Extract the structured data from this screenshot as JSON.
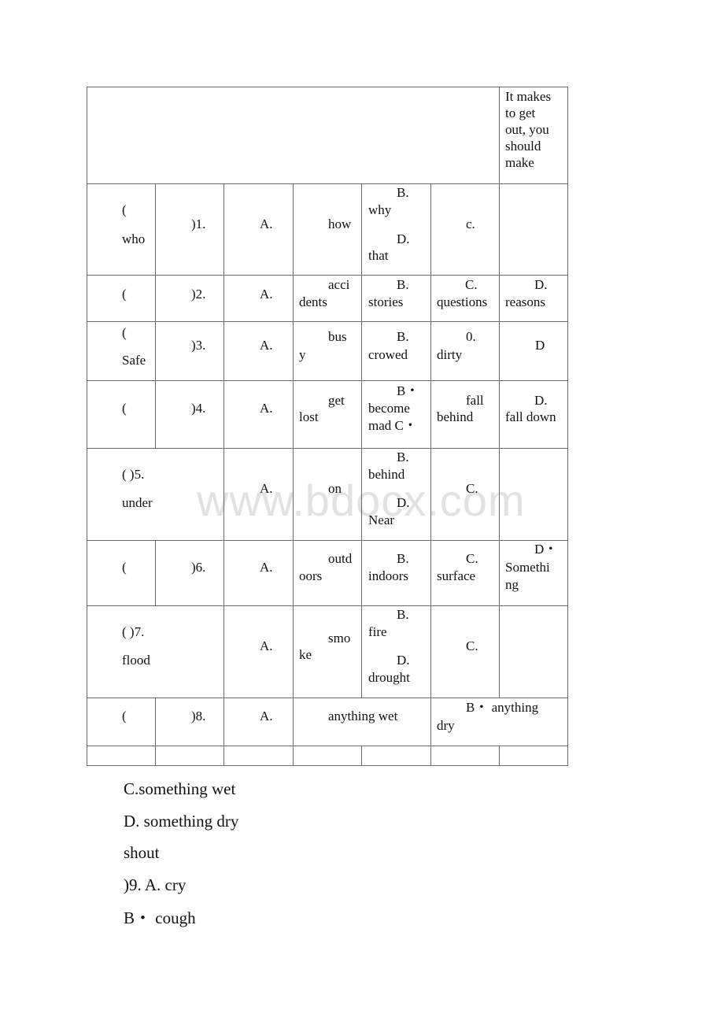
{
  "watermark": "www.bdocx.com",
  "header_cell": [
    "It makes",
    "to get",
    "out, you",
    "should",
    "make"
  ],
  "rows": {
    "q1": {
      "paren": "(",
      "extra": "who",
      "num": ")1.",
      "a": "A.",
      "a_text": "how",
      "b_label": "B.",
      "b_text": "why",
      "d_label": "D.",
      "d_text": "that",
      "c": "c."
    },
    "q2": {
      "paren": "(",
      "num": ")2.",
      "a": "A.",
      "a_text1": "acci",
      "a_text2": "dents",
      "b_label": "B.",
      "b_text": "stories",
      "c_label": "C.",
      "c_text": "questions",
      "d_label": "D.",
      "d_text": "reasons"
    },
    "q3": {
      "paren": "(",
      "extra": "Safe",
      "num": ")3.",
      "a": "A.",
      "a_text1": "bus",
      "a_text2": "y",
      "b_label": "B.",
      "b_text": "crowed",
      "c_label": "0.",
      "c_text": "dirty",
      "d": "D"
    },
    "q4": {
      "paren": "(",
      "num": ")4.",
      "a": "A.",
      "a_text1": "get",
      "a_text2": "lost",
      "b_label": "B・",
      "b_text1": "become",
      "b_text2": "mad C・",
      "c_text1": "fall",
      "c_text2": "behind",
      "d_label": "D.",
      "d_text": "fall down"
    },
    "q5": {
      "num": "( )5.",
      "extra": "under",
      "a": "A.",
      "a_text": "on",
      "b_label": "B.",
      "b_text": "behind",
      "d_label": "D.",
      "d_text": "Near",
      "c": "C."
    },
    "q6": {
      "paren": "(",
      "num": ")6.",
      "a": "A.",
      "a_text1": "outd",
      "a_text2": "oors",
      "b_label": "B.",
      "b_text": "indoors",
      "c_label": "C.",
      "c_text": "surface",
      "d_label": "D・",
      "d_text1": "Somethi",
      "d_text2": "ng"
    },
    "q7": {
      "num": "( )7.",
      "extra": "flood",
      "a": "A.",
      "a_text1": "smo",
      "a_text2": "ke",
      "b_label": "B.",
      "b_text": "fire",
      "d_label": "D.",
      "d_text": "drought",
      "c": "C."
    },
    "q8": {
      "paren": "(",
      "num": ")8.",
      "a": "A.",
      "a_text": "anything wet",
      "b_text1": "B・ anything",
      "b_text2": "dry"
    }
  },
  "below_lines": [
    "C.something wet",
    "D. something dry",
    "shout",
    ")9. A. cry",
    "B・ cough"
  ]
}
